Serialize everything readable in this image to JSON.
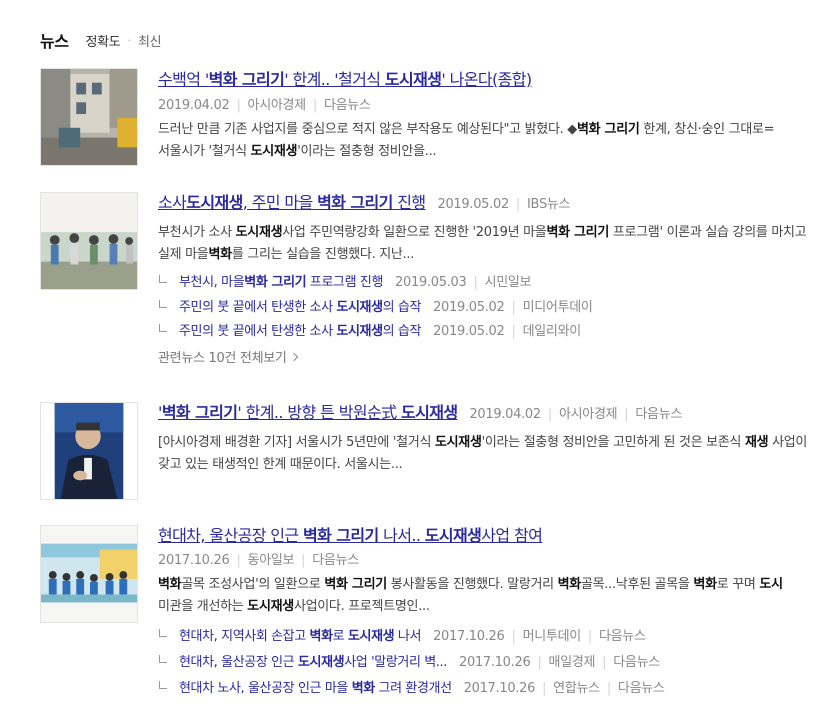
{
  "header": {
    "title": "뉴스",
    "sort_accuracy": "정확도",
    "sort_dot": "·",
    "sort_latest": "최신"
  },
  "articles": [
    {
      "title_parts": [
        "수백억 '",
        "벽화 그리기",
        "' 한계.. '철거식 ",
        "도시재생",
        "' 나온다(종합)"
      ],
      "date": "2019.04.02",
      "source": "아시아경제",
      "via": "다음뉴스",
      "desc_parts": [
        "드러난 만큼 기존 사업지를 중심으로 적지 않은 부작용도 예상된다\"고 밝혔다. ◆",
        "벽화 그리기",
        " 한계, 창신·숭인 그대로= 서울시가 '철거식 ",
        "도시재생",
        "'이라는 절충형 정비안을..."
      ],
      "thumb_icon": "street-photo"
    },
    {
      "title_parts": [
        "소사",
        "도시재생",
        ", 주민 마을 ",
        "벽화 그리기",
        " 진행"
      ],
      "date": "2019.05.02",
      "source": "IBS뉴스",
      "desc_parts": [
        "부천시가 소사 ",
        "도시재생",
        "사업 주민역량강화 일환으로 진행한 '2019년 마을",
        "벽화 그리기",
        " 프로그램' 이론과 실습 강의를 마치고 실제 마을",
        "벽화",
        "를 그리는 실습을 진행했다. 지난..."
      ],
      "thumb_icon": "mural-photo",
      "related": [
        {
          "parts": [
            "부천시, 마을",
            "벽화 그리기",
            " 프로그램 진행"
          ],
          "date": "2019.05.03",
          "source": "시민일보"
        },
        {
          "parts": [
            "주민의 붓 끝에서 탄생한 소사 ",
            "도시재생",
            "의 습작"
          ],
          "date": "2019.05.02",
          "source": "미디어투데이"
        },
        {
          "parts": [
            "주민의 붓 끝에서 탄생한 소사 ",
            "도시재생",
            "의 습작"
          ],
          "date": "2019.05.02",
          "source": "데일리와이"
        }
      ],
      "more_text": "관련뉴스 10건 전체보기"
    },
    {
      "title_parts": [
        "'",
        "벽화 그리기",
        "' 한계.. 방향 튼 박원순式 ",
        "도시재생",
        ""
      ],
      "date": "2019.04.02",
      "source": "아시아경제",
      "via": "다음뉴스",
      "desc_parts": [
        "[아시아경제 배경환 기자] 서울시가 5년만에 '철거식 ",
        "도시재생",
        "'이라는 절충형 정비안을 고민하게 된 것은 보존식 ",
        "재생",
        " 사업이 갖고 있는 태생적인 한계 때문이다. 서울시는..."
      ],
      "thumb_icon": "portrait-photo"
    },
    {
      "title_parts": [
        "현대차, 울산공장 인근 ",
        "벽화 그리기",
        " 나서.. ",
        "도시재생",
        "사업 참여"
      ],
      "date": "2017.10.26",
      "source": "동아일보",
      "via": "다음뉴스",
      "desc_parts": [
        "",
        "벽화",
        "골목 조성사업'의 일환으로 ",
        "벽화 그리기",
        " 봉사활동을 진행했다. 말랑거리 ",
        "벽화",
        "골목...낙후된 골목을 ",
        "벽화",
        "로 꾸며 ",
        "도시",
        " 미관을 개선하는 ",
        "도시재생",
        "사업이다. 프로젝트명인..."
      ],
      "thumb_icon": "volunteers-photo",
      "related": [
        {
          "parts": [
            "현대차, 지역사회 손잡고 ",
            "벽화",
            "로 ",
            "도시재생",
            " 나서"
          ],
          "date": "2017.10.26",
          "source": "머니투데이",
          "via": "다음뉴스"
        },
        {
          "parts": [
            "현대차, 울산공장 인근 ",
            "도시재생",
            "사업 '말랑거리 벽..."
          ],
          "date": "2017.10.26",
          "source": "매일경제",
          "via": "다음뉴스"
        },
        {
          "parts": [
            "현대차 노사, 울산공장 인근 마을 ",
            "벽화",
            " 그려 환경개선"
          ],
          "date": "2017.10.26",
          "source": "연합뉴스",
          "via": "다음뉴스"
        }
      ]
    }
  ]
}
